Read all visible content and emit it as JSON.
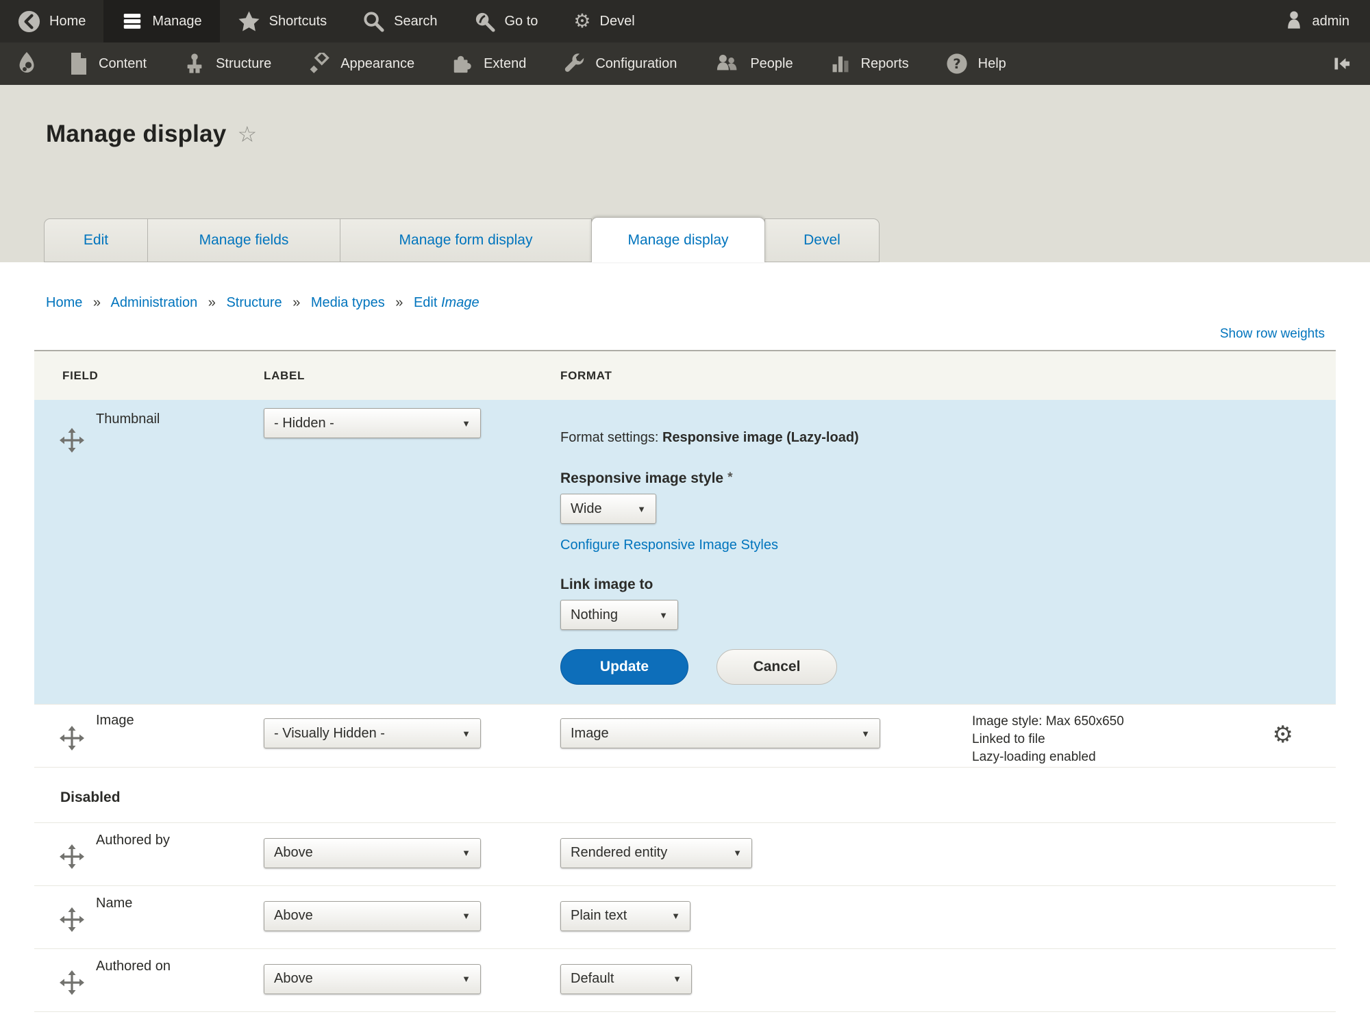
{
  "toolbar_top": {
    "items": [
      {
        "label": "Home",
        "icon": "back-circle-icon"
      },
      {
        "label": "Manage",
        "icon": "hamburger-icon",
        "active": true
      },
      {
        "label": "Shortcuts",
        "icon": "star-icon"
      },
      {
        "label": "Search",
        "icon": "magnifier-icon"
      },
      {
        "label": "Go to",
        "icon": "goto-magnifier-icon"
      },
      {
        "label": "Devel",
        "icon": "gear-icon"
      }
    ],
    "user": {
      "label": "admin",
      "icon": "person-icon"
    },
    "gear_glyph": "⚙"
  },
  "toolbar_admin": {
    "items": [
      {
        "label": "Content",
        "icon": "document-icon"
      },
      {
        "label": "Structure",
        "icon": "structure-icon"
      },
      {
        "label": "Appearance",
        "icon": "paintbrush-icon"
      },
      {
        "label": "Extend",
        "icon": "puzzle-icon"
      },
      {
        "label": "Configuration",
        "icon": "wrench-icon"
      },
      {
        "label": "People",
        "icon": "people-icon"
      },
      {
        "label": "Reports",
        "icon": "bar-chart-icon"
      },
      {
        "label": "Help",
        "icon": "question-icon"
      }
    ],
    "logo_icon": "drupal-logo-icon",
    "collapse_icon": "collapse-left-icon"
  },
  "page": {
    "title": "Manage display",
    "favorite_star": "☆"
  },
  "tabs": [
    {
      "label": "Edit"
    },
    {
      "label": "Manage fields"
    },
    {
      "label": "Manage form display"
    },
    {
      "label": "Manage display",
      "active": true
    },
    {
      "label": "Devel"
    }
  ],
  "breadcrumb": {
    "separator": "»",
    "links": [
      "Home",
      "Administration",
      "Structure",
      "Media types"
    ],
    "current": "Edit",
    "current_emphasis": "Image"
  },
  "table": {
    "show_row_weights": "Show row weights",
    "headers": {
      "field": "FIELD",
      "label": "LABEL",
      "format": "FORMAT"
    },
    "select_arrow": "▼",
    "thumbnail_row": {
      "field": "Thumbnail",
      "label_value": "- Hidden -",
      "settings": {
        "prefix": "Format settings:",
        "formatter_name": "Responsive image (Lazy-load)",
        "style_label": "Responsive image style",
        "required_mark": "*",
        "style_value": "Wide",
        "configure_link": "Configure Responsive Image Styles",
        "link_label": "Link image to",
        "link_value": "Nothing",
        "update_label": "Update",
        "cancel_label": "Cancel"
      }
    },
    "image_row": {
      "field": "Image",
      "label_value": "- Visually Hidden -",
      "format_value": "Image",
      "summary": [
        "Image style: Max 650x650",
        "Linked to file",
        "Lazy-loading enabled"
      ],
      "gear_glyph": "⚙"
    },
    "disabled_heading": "Disabled",
    "disabled_rows": [
      {
        "field": "Authored by",
        "label_value": "Above",
        "format_value": "Rendered entity"
      },
      {
        "field": "Name",
        "label_value": "Above",
        "format_value": "Plain text"
      },
      {
        "field": "Authored on",
        "label_value": "Above",
        "format_value": "Default"
      }
    ]
  },
  "colors": {
    "accent_blue": "#0074bd",
    "button_blue": "#0d6eba",
    "row_highlight": "#d7eaf3",
    "toolbar_dark": "#2b2a27",
    "toolbar_secondary": "#353430",
    "header_band": "#dfded6"
  }
}
